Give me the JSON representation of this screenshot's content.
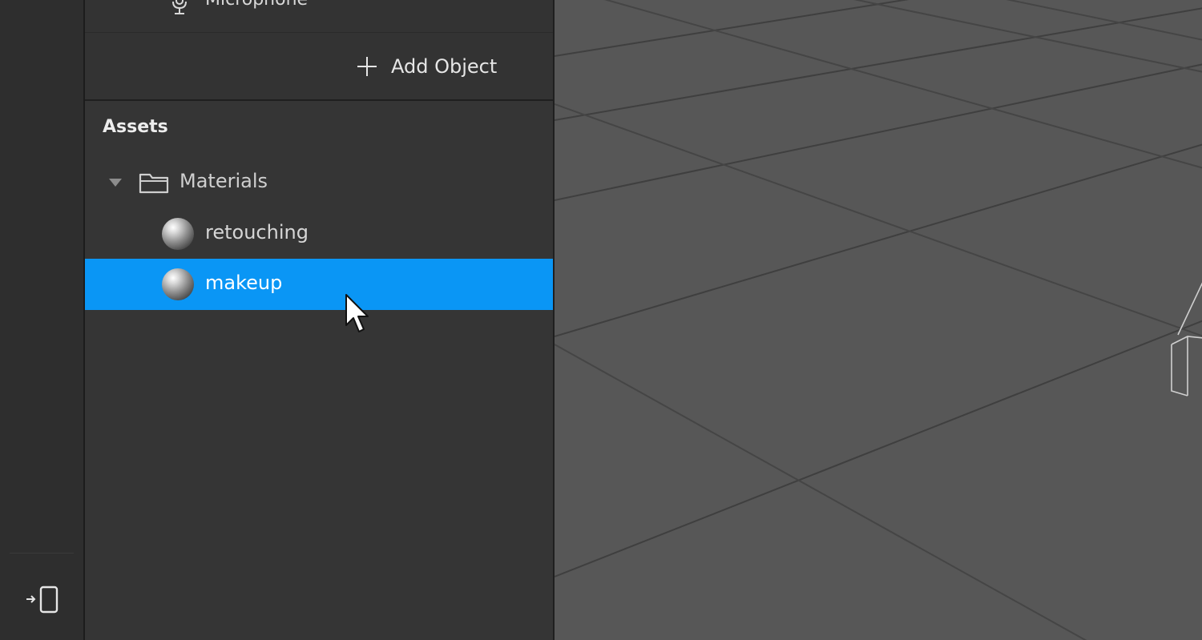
{
  "scene": {
    "partial_item": {
      "label": "Microphone",
      "icon": "microphone-icon"
    },
    "add_object_label": "Add Object"
  },
  "assets": {
    "title": "Assets",
    "folder": {
      "label": "Materials",
      "expanded": true,
      "icon": "folder-icon"
    },
    "items": [
      {
        "label": "retouching",
        "icon": "material-sphere-icon",
        "selected": false
      },
      {
        "label": "makeup",
        "icon": "material-sphere-icon",
        "selected": true
      }
    ]
  },
  "toolbar": {
    "preview_icon": "device-preview-icon"
  },
  "colors": {
    "selection": "#0a96f5",
    "panel_bg": "#353535",
    "viewport_bg": "#575757",
    "grid_line": "#3f3f3f"
  }
}
